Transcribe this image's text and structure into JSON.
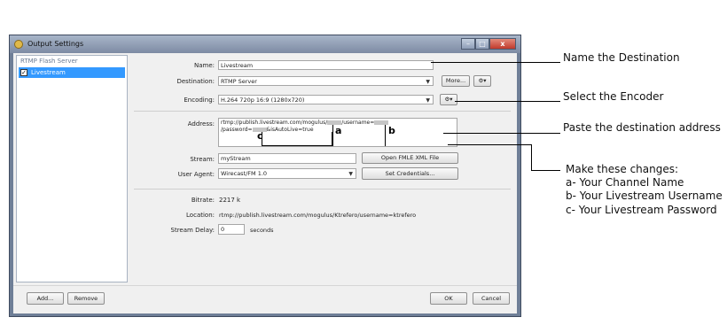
{
  "window": {
    "title": "Output Settings",
    "min": "–",
    "max": "□",
    "close": "x"
  },
  "sidebar": {
    "header": "RTMP Flash Server",
    "items": [
      {
        "label": "Livestream",
        "checked": "✓"
      }
    ]
  },
  "form": {
    "name_label": "Name:",
    "name_value": "Livestream",
    "destination_label": "Destination:",
    "destination_value": "RTMP Server",
    "more_button": "More...",
    "gear": "⚙▾",
    "encoding_label": "Encoding:",
    "encoding_value": "H.264 720p 16:9 (1280x720)",
    "address_label": "Address:",
    "address_line1a": "rtmp://publish.livestream.com/mogulus/",
    "address_line1b": "/username=",
    "address_line2a": "/password=",
    "address_line2b": "&isAutoLive=true",
    "marker_c": "c",
    "marker_a": "a",
    "marker_b": "b",
    "stream_label": "Stream:",
    "stream_value": "myStream",
    "open_fmle_button": "Open FMLE XML File",
    "user_agent_label": "User Agent:",
    "user_agent_value": "Wirecast/FM 1.0",
    "set_credentials_button": "Set Credentials...",
    "bitrate_label": "Bitrate:",
    "bitrate_value": "2217 k",
    "location_label": "Location:",
    "location_value": "rtmp://publish.livestream.com/mogulus/Ktrefero/username=ktrefero",
    "stream_delay_label": "Stream Delay:",
    "stream_delay_value": "0",
    "stream_delay_unit": "seconds"
  },
  "footer": {
    "add": "Add...",
    "remove": "Remove",
    "ok": "OK",
    "cancel": "Cancel"
  },
  "annotations": {
    "name": "Name the Destination",
    "encoder": "Select the Encoder",
    "address": "Paste the destination address",
    "changes_title": "Make these changes:",
    "change_a": "a- Your Channel Name",
    "change_b": "b- Your Livestream Username",
    "change_c": "c- Your Livestream Password"
  },
  "colors": {
    "selection": "#3399ff",
    "window_frame": "#6f7f97",
    "close_button": "#c0392b"
  }
}
